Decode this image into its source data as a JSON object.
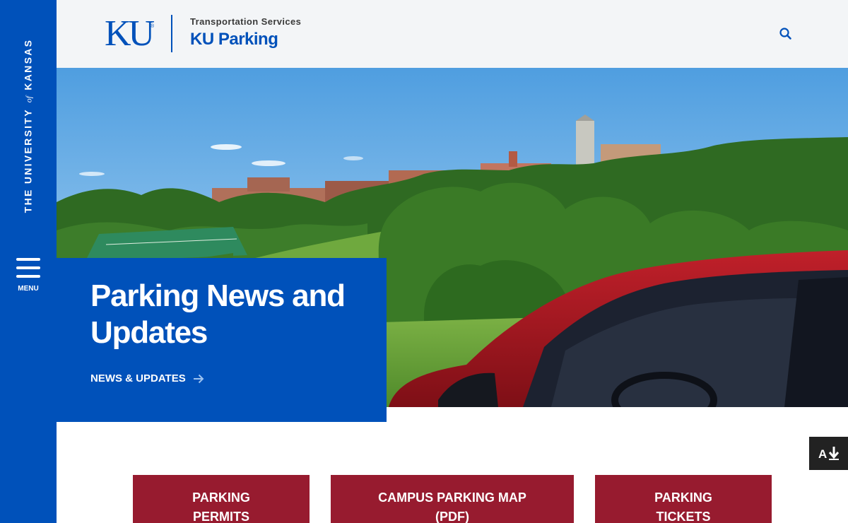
{
  "sidebar": {
    "univ_pre": "THE UNIVERSITY",
    "univ_of": "of",
    "univ_post": "KANSAS",
    "menu_label": "MENU"
  },
  "header": {
    "logo_text": "KU",
    "logo_mark": "®",
    "department": "Transportation Services",
    "site_name": "KU Parking",
    "search_icon": "search-icon"
  },
  "hero": {
    "image_description": "KU campus on the hill behind trees, red car in foreground",
    "title": "Parking News and Updates",
    "link_label": "NEWS & UPDATES",
    "link_icon": "arrow-right-icon"
  },
  "accessibility": {
    "icon": "text-to-speech-download-icon"
  },
  "quick_links": [
    {
      "line1": "PARKING",
      "line2": "PERMITS"
    },
    {
      "line1": "CAMPUS PARKING MAP",
      "line2": "(PDF)"
    },
    {
      "line1": "PARKING",
      "line2": "TICKETS"
    }
  ],
  "colors": {
    "ku_blue": "#0051ba",
    "crimson": "#971b2f",
    "header_bg": "#f3f5f7",
    "dark": "#222222"
  }
}
